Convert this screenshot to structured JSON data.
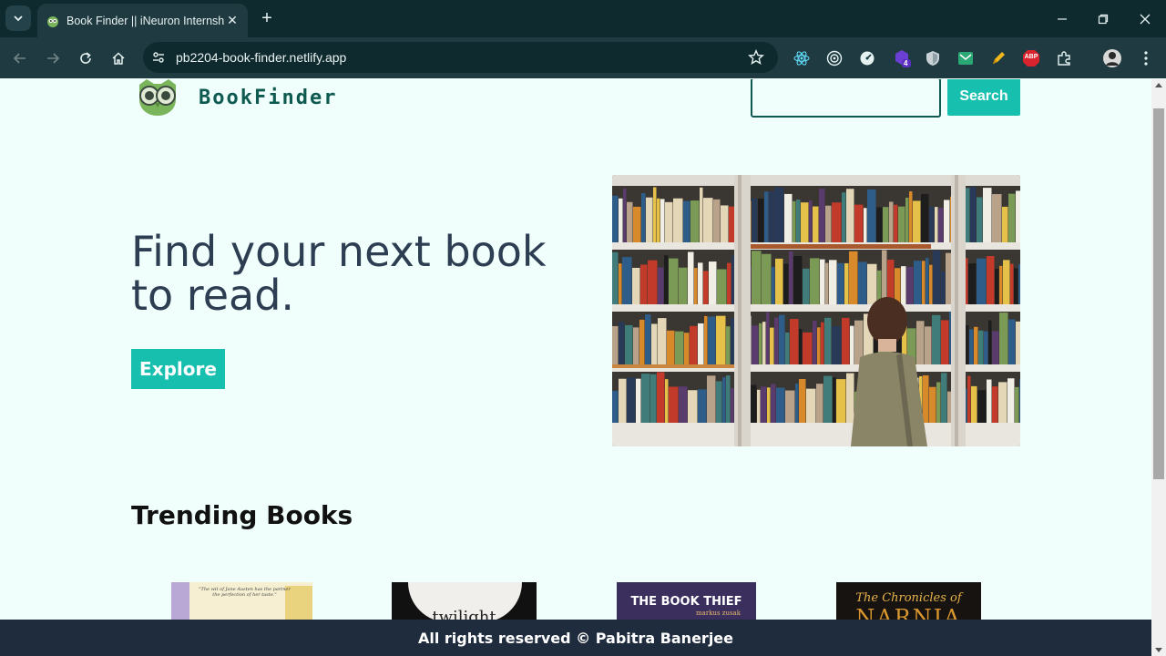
{
  "browser": {
    "tab_title": "Book Finder || iNeuron Internship",
    "url": "pb2204-book-finder.netlify.app",
    "extension_badge": "4",
    "abp_label": "ABP"
  },
  "header": {
    "brand": "BookFinder",
    "search_value": "",
    "search_button": "Search"
  },
  "hero": {
    "title": "Find your next book to read.",
    "explore_button": "Explore"
  },
  "trending": {
    "title": "Trending Books",
    "books": [
      {
        "cover_text": "\"The wit of Jane Austen has the partner the perfection of her taste.\""
      },
      {
        "cover_text": "twilight"
      },
      {
        "cover_text": "THE BOOK THIEF",
        "cover_subtext": "markus zusak"
      },
      {
        "cover_text": "The Chronicles of",
        "cover_subtext": "NARNIA"
      }
    ]
  },
  "footer": {
    "text": "All rights reserved © Pabitra Banerjee"
  },
  "colors": {
    "accent": "#17bfae",
    "brand": "#0f5a50",
    "page_bg": "#f0fffb",
    "footer_bg": "#1f2c3d",
    "hero_text": "#2d3d52"
  }
}
